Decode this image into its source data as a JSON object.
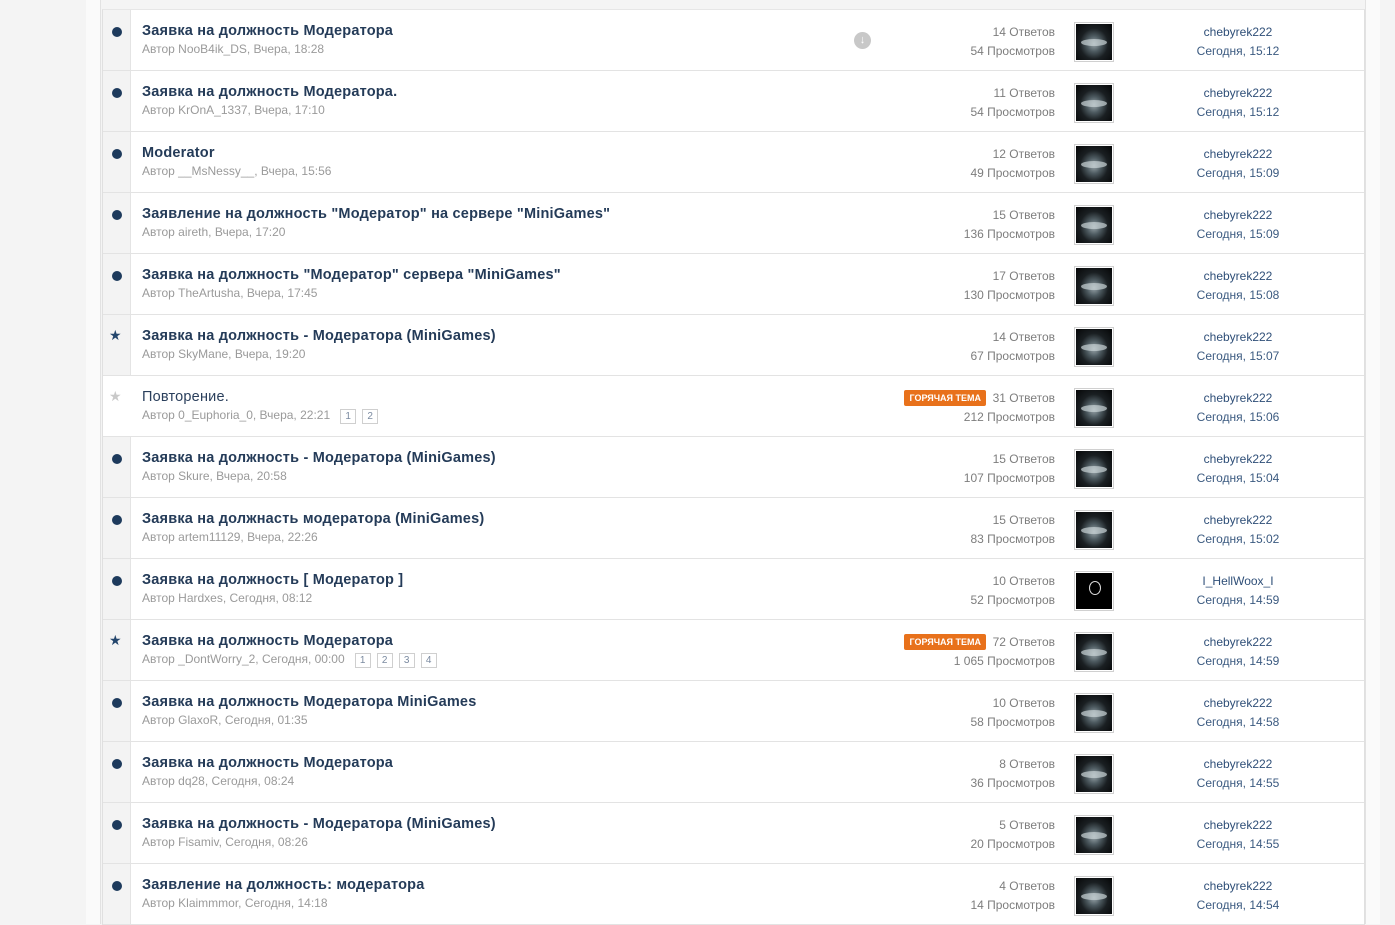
{
  "hot_label": "ГОРЯЧАЯ ТЕМА",
  "accent_color": "#1d3a5c",
  "hot_color": "#e8711b",
  "threads": [
    {
      "title": "Заявка на должность Модератора",
      "author_line": "Автор NooB4ik_DS, Вчера, 18:28",
      "replies": "14 Ответов",
      "views": "54 Просмотров",
      "last_user": "chebyrek222",
      "last_time": "Сегодня, 15:12",
      "icon": "dot",
      "hot": false,
      "pages": [],
      "jump": true
    },
    {
      "title": "Заявка на должность Модератора.",
      "author_line": "Автор KrOnA_1337, Вчера, 17:10",
      "replies": "11 Ответов",
      "views": "54 Просмотров",
      "last_user": "chebyrek222",
      "last_time": "Сегодня, 15:12",
      "icon": "dot",
      "hot": false,
      "pages": []
    },
    {
      "title": "Moderator",
      "author_line": "Автор __MsNessy__, Вчера, 15:56",
      "replies": "12 Ответов",
      "views": "49 Просмотров",
      "last_user": "chebyrek222",
      "last_time": "Сегодня, 15:09",
      "icon": "dot",
      "hot": false,
      "pages": []
    },
    {
      "title": "Заявление на должность \"Модератор\" на сервере \"MiniGames\"",
      "author_line": "Автор aireth, Вчера, 17:20",
      "replies": "15 Ответов",
      "views": "136 Просмотров",
      "last_user": "chebyrek222",
      "last_time": "Сегодня, 15:09",
      "icon": "dot",
      "hot": false,
      "pages": []
    },
    {
      "title": "Заявка на должность \"Модератор\" сервера \"MiniGames\"",
      "author_line": "Автор TheArtusha, Вчера, 17:45",
      "replies": "17 Ответов",
      "views": "130 Просмотров",
      "last_user": "chebyrek222",
      "last_time": "Сегодня, 15:08",
      "icon": "dot",
      "hot": false,
      "pages": []
    },
    {
      "title": "Заявка на должность - Модератора (MiniGames)",
      "author_line": "Автор SkyMane, Вчера, 19:20",
      "replies": "14 Ответов",
      "views": "67 Просмотров",
      "last_user": "chebyrek222",
      "last_time": "Сегодня, 15:07",
      "icon": "star",
      "hot": false,
      "pages": []
    },
    {
      "title": "Повторение.",
      "author_line": "Автор 0_Euphoria_0, Вчера, 22:21",
      "replies": "31 Ответов",
      "views": "212 Просмотров",
      "last_user": "chebyrek222",
      "last_time": "Сегодня, 15:06",
      "icon": "star-grey",
      "hot": true,
      "pages": [
        "1",
        "2"
      ],
      "read": true
    },
    {
      "title": "Заявка на должность - Модератора (MiniGames)",
      "author_line": "Автор Skure, Вчера, 20:58",
      "replies": "15 Ответов",
      "views": "107 Просмотров",
      "last_user": "chebyrek222",
      "last_time": "Сегодня, 15:04",
      "icon": "dot",
      "hot": false,
      "pages": []
    },
    {
      "title": "Заявка на должнасть модератора (MiniGames)",
      "author_line": "Автор artem11129, Вчера, 22:26",
      "replies": "15 Ответов",
      "views": "83 Просмотров",
      "last_user": "chebyrek222",
      "last_time": "Сегодня, 15:02",
      "icon": "dot",
      "hot": false,
      "pages": []
    },
    {
      "title": "Заявка на должность [ Модератор ]",
      "author_line": "Автор Hardxes, Сегодня, 08:12",
      "replies": "10 Ответов",
      "views": "52 Просмотров",
      "last_user": "I_HellWoox_I",
      "last_time": "Сегодня, 14:59",
      "icon": "dot",
      "hot": false,
      "pages": [],
      "dark_avatar": true
    },
    {
      "title": "Заявка на должность Модератора",
      "author_line": "Автор _DontWorry_2, Сегодня, 00:00",
      "replies": "72 Ответов",
      "views": "1 065 Просмотров",
      "last_user": "chebyrek222",
      "last_time": "Сегодня, 14:59",
      "icon": "star",
      "hot": true,
      "pages": [
        "1",
        "2",
        "3",
        "4"
      ]
    },
    {
      "title": "Заявка на должность Модератора MiniGames",
      "author_line": "Автор GlaxoR, Сегодня, 01:35",
      "replies": "10 Ответов",
      "views": "58 Просмотров",
      "last_user": "chebyrek222",
      "last_time": "Сегодня, 14:58",
      "icon": "dot",
      "hot": false,
      "pages": []
    },
    {
      "title": "Заявка на должность Модератора",
      "author_line": "Автор dq28, Сегодня, 08:24",
      "replies": "8 Ответов",
      "views": "36 Просмотров",
      "last_user": "chebyrek222",
      "last_time": "Сегодня, 14:55",
      "icon": "dot",
      "hot": false,
      "pages": []
    },
    {
      "title": "Заявка на должность - Модератора (MiniGames)",
      "author_line": "Автор Fisamiv, Сегодня, 08:26",
      "replies": "5 Ответов",
      "views": "20 Просмотров",
      "last_user": "chebyrek222",
      "last_time": "Сегодня, 14:55",
      "icon": "dot",
      "hot": false,
      "pages": []
    },
    {
      "title": "Заявление на должность: модератора",
      "author_line": "Автор Klaimmmor, Сегодня, 14:18",
      "replies": "4 Ответов",
      "views": "14 Просмотров",
      "last_user": "chebyrek222",
      "last_time": "Сегодня, 14:54",
      "icon": "dot",
      "hot": false,
      "pages": []
    }
  ]
}
